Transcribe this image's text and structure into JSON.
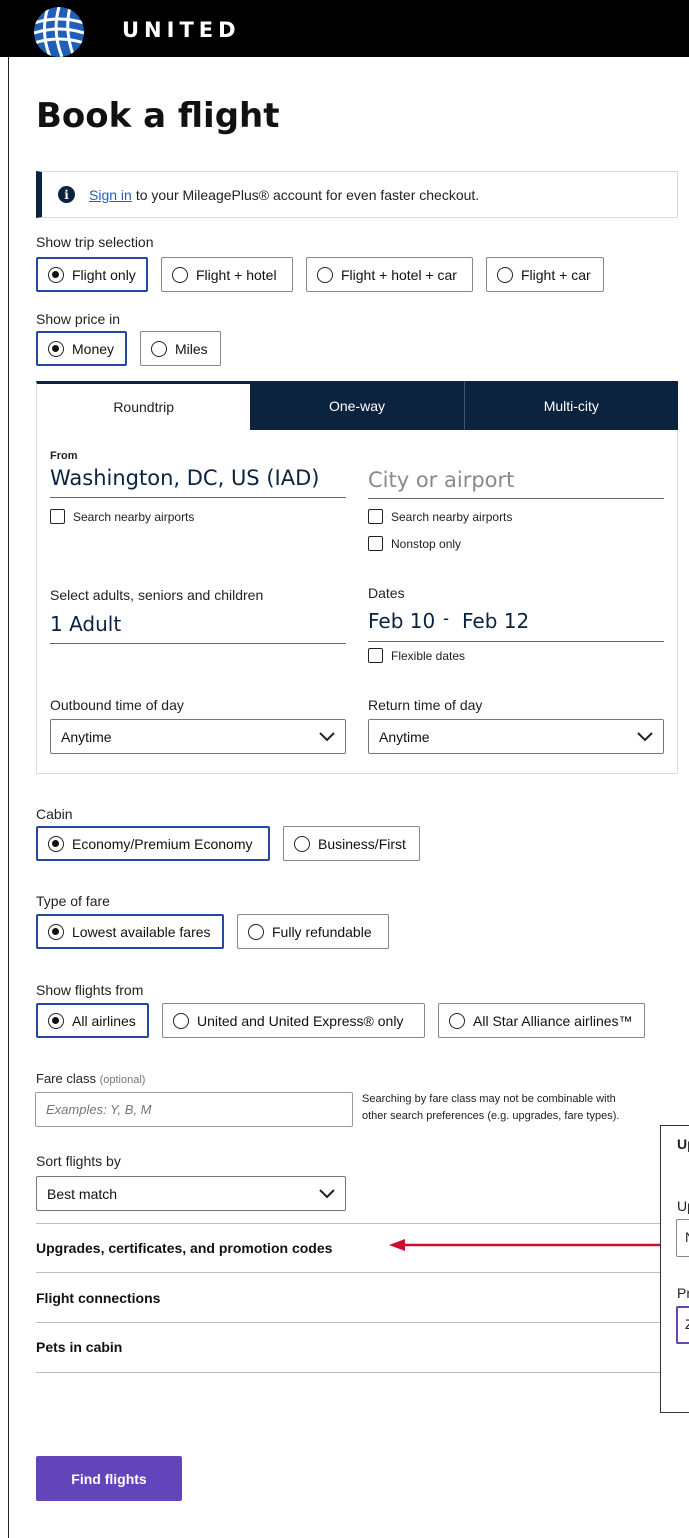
{
  "header": {
    "brand": "UNITED",
    "logo_icon": "globe-icon"
  },
  "page": {
    "title": "Book a flight"
  },
  "signin_banner": {
    "link": "Sign in",
    "text": "to your MileagePlus® account for even faster checkout."
  },
  "trip_selection": {
    "label": "Show trip selection",
    "options": [
      "Flight only",
      "Flight + hotel",
      "Flight + hotel + car",
      "Flight + car"
    ],
    "selected": "Flight only"
  },
  "price": {
    "label": "Show price in",
    "options": [
      "Money",
      "Miles"
    ],
    "selected": "Money"
  },
  "tabs": [
    "Roundtrip",
    "One-way",
    "Multi-city"
  ],
  "active_tab": "Roundtrip",
  "search": {
    "from_label": "From",
    "from_value": "Washington, DC, US (IAD)",
    "to_placeholder": "City or airport",
    "nearby_from": "Search nearby airports",
    "nearby_to": "Search nearby airports",
    "nonstop": "Nonstop only",
    "travelers_label": "Select adults, seniors and children",
    "travelers_value": "1 Adult",
    "dates_label": "Dates",
    "depart_date": "Feb 10",
    "date_separator": "-",
    "return_date": "Feb 12",
    "flexible": "Flexible dates",
    "outbound_label": "Outbound time of day",
    "outbound_value": "Anytime",
    "return_label": "Return time of day",
    "return_value": "Anytime"
  },
  "cabin": {
    "label": "Cabin",
    "options": [
      "Economy/Premium Economy",
      "Business/First"
    ],
    "selected": "Economy/Premium Economy"
  },
  "fare": {
    "label": "Type of fare",
    "options": [
      "Lowest available fares",
      "Fully refundable"
    ],
    "selected": "Lowest available fares"
  },
  "airlines": {
    "label": "Show flights from",
    "options": [
      "All airlines",
      "United and United Express® only",
      "All Star Alliance airlines™"
    ],
    "selected": "All airlines"
  },
  "fare_class": {
    "label": "Fare class",
    "optional": "(optional)",
    "placeholder": "Examples: Y, B, M",
    "note_line1": "Searching by fare class may not be combinable with",
    "note_line2": "other search preferences (e.g. upgrades, fare types)."
  },
  "sort": {
    "label": "Sort flights by",
    "value": "Best match"
  },
  "accordions": [
    "Upgrades, certificates, and promotion codes",
    "Flight connections",
    "Pets in cabin"
  ],
  "overlay_panel": {
    "title": "Up",
    "field1_label": "Up",
    "field1_value": "N",
    "field2_label": "Pr",
    "field2_value": "Z"
  },
  "find_button": "Find flights",
  "colors": {
    "navy": "#0c2340",
    "purple": "#6244bb",
    "arrow_red": "#c8102e",
    "link_blue": "#1f5fb8"
  }
}
